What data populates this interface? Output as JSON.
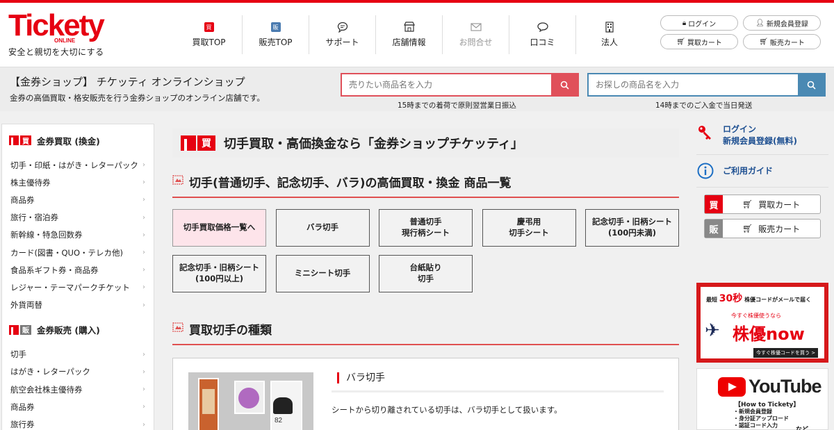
{
  "header": {
    "logo": "Tickety",
    "logo_sub": "ONLINE",
    "tagline": "安全と親切を大切にする",
    "nav": [
      {
        "label": "買取TOP",
        "icon": "買"
      },
      {
        "label": "販売TOP",
        "icon": "販"
      },
      {
        "label": "サポート",
        "icon": "chat-icon"
      },
      {
        "label": "店舗情報",
        "icon": "shop-icon"
      },
      {
        "label": "お問合せ",
        "icon": "mail-icon"
      },
      {
        "label": "口コミ",
        "icon": "comment-icon"
      },
      {
        "label": "法人",
        "icon": "building-icon"
      }
    ],
    "account": {
      "login": "ログイン",
      "register": "新規会員登録",
      "buy_cart": "買取カート",
      "sell_cart": "販売カート"
    }
  },
  "band": {
    "title": "【金券ショップ】 チケッティ オンラインショップ",
    "desc": "金券の高価買取・格安販売を行う金券ショップのオンライン店舗です。",
    "sell_search_placeholder": "売りたい商品名を入力",
    "sell_note": "15時までの着荷で原則翌営業日振込",
    "buy_search_placeholder": "お探しの商品名を入力",
    "buy_note": "14時までのご入金で当日発送"
  },
  "sidebar": {
    "buy_head": "金券買取 (換金)",
    "buy_mark": "買",
    "buy_items": [
      "切手・印紙・はがき・レターパック",
      "株主優待券",
      "商品券",
      "旅行・宿泊券",
      "新幹線・特急回数券",
      "カード(図書・QUO・テレカ他)",
      "食品系ギフト券・商品券",
      "レジャー・テーマパークチケット",
      "外貨両替"
    ],
    "sell_head": "金券販売 (購入)",
    "sell_mark": "販",
    "sell_items": [
      "切手",
      "はがき・レターパック",
      "航空会社株主優待券",
      "商品券",
      "旅行券"
    ]
  },
  "main": {
    "page_title": "切手買取・高価換金なら「金券ショップチケッティ」",
    "section1": "切手(普通切手、記念切手、バラ)の高価買取・換金 商品一覧",
    "buttons": [
      "切手買取価格一覧へ",
      "バラ切手",
      "普通切手\n現行柄シート",
      "慶弔用\n切手シート",
      "記念切手・旧柄シート\n(100円未満)",
      "記念切手・旧柄シート\n(100円以上)",
      "ミニシート切手",
      "台紙貼り\n切手"
    ],
    "section2": "買取切手の種類",
    "card": {
      "title": "バラ切手",
      "text": "シートから切り離されている切手は、バラ切手として扱います。",
      "stamp_value": "82"
    }
  },
  "right": {
    "login": "ログイン",
    "register": "新規会員登録(無料)",
    "guide": "ご利用ガイド",
    "buy_tag": "買",
    "buy_cart": "買取カート",
    "sell_tag": "販",
    "sell_cart": "販売カート",
    "banner1": {
      "top_pre": "最短",
      "top_num": "30秒",
      "top_post": "株優コードがメールで届く",
      "mid": "今すぐ株優使うなら",
      "logo": "株優now",
      "btn": "今すぐ株優コードを買う >"
    },
    "banner2": {
      "logo": "YouTube",
      "how": "【How to Tickety】",
      "list": [
        "・新規会員登録",
        "・身分証アップロード",
        "・認証コード入力"
      ],
      "etc": "など"
    }
  },
  "colors": {
    "brand_red": "#e60012",
    "sell_search": "#e0505a",
    "buy_search": "#4a89b3",
    "link_blue": "#1d4f91"
  }
}
